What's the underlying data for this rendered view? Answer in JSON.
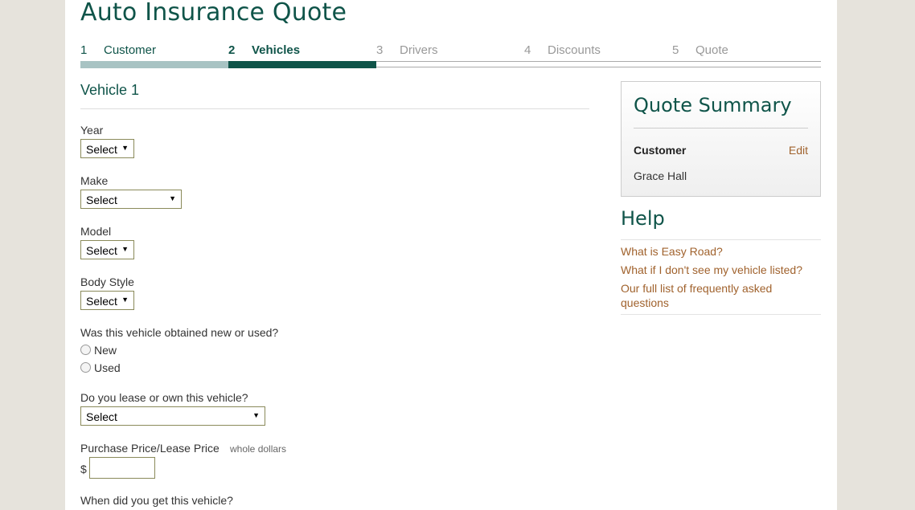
{
  "header": {
    "title": "Auto Insurance Quote"
  },
  "steps": [
    {
      "num": "1",
      "label": "Customer"
    },
    {
      "num": "2",
      "label": "Vehicles"
    },
    {
      "num": "3",
      "label": "Drivers"
    },
    {
      "num": "4",
      "label": "Discounts"
    },
    {
      "num": "5",
      "label": "Quote"
    }
  ],
  "current_step": 2,
  "form": {
    "section_title": "Vehicle 1",
    "year": {
      "label": "Year",
      "value": "Select"
    },
    "make": {
      "label": "Make",
      "value": "Select"
    },
    "model": {
      "label": "Model",
      "value": "Select"
    },
    "body_style": {
      "label": "Body Style",
      "value": "Select"
    },
    "condition": {
      "question": "Was this vehicle obtained new or used?",
      "options": [
        "New",
        "Used"
      ]
    },
    "ownership": {
      "question": "Do you lease or own this vehicle?",
      "value": "Select"
    },
    "price": {
      "label": "Purchase Price/Lease Price",
      "hint": "whole dollars",
      "currency": "$",
      "value": ""
    },
    "acquired": {
      "question": "When did you get this vehicle?"
    }
  },
  "summary": {
    "title": "Quote Summary",
    "customer_label": "Customer",
    "edit_label": "Edit",
    "customer_name": "Grace Hall"
  },
  "help": {
    "title": "Help",
    "links": [
      "What is Easy Road?",
      "What if I don't see my vehicle listed?",
      "Our full list of frequently asked questions"
    ]
  },
  "colors": {
    "brand": "#0f5449",
    "link": "#a0622d",
    "progress_done": "#a8c3c3"
  }
}
